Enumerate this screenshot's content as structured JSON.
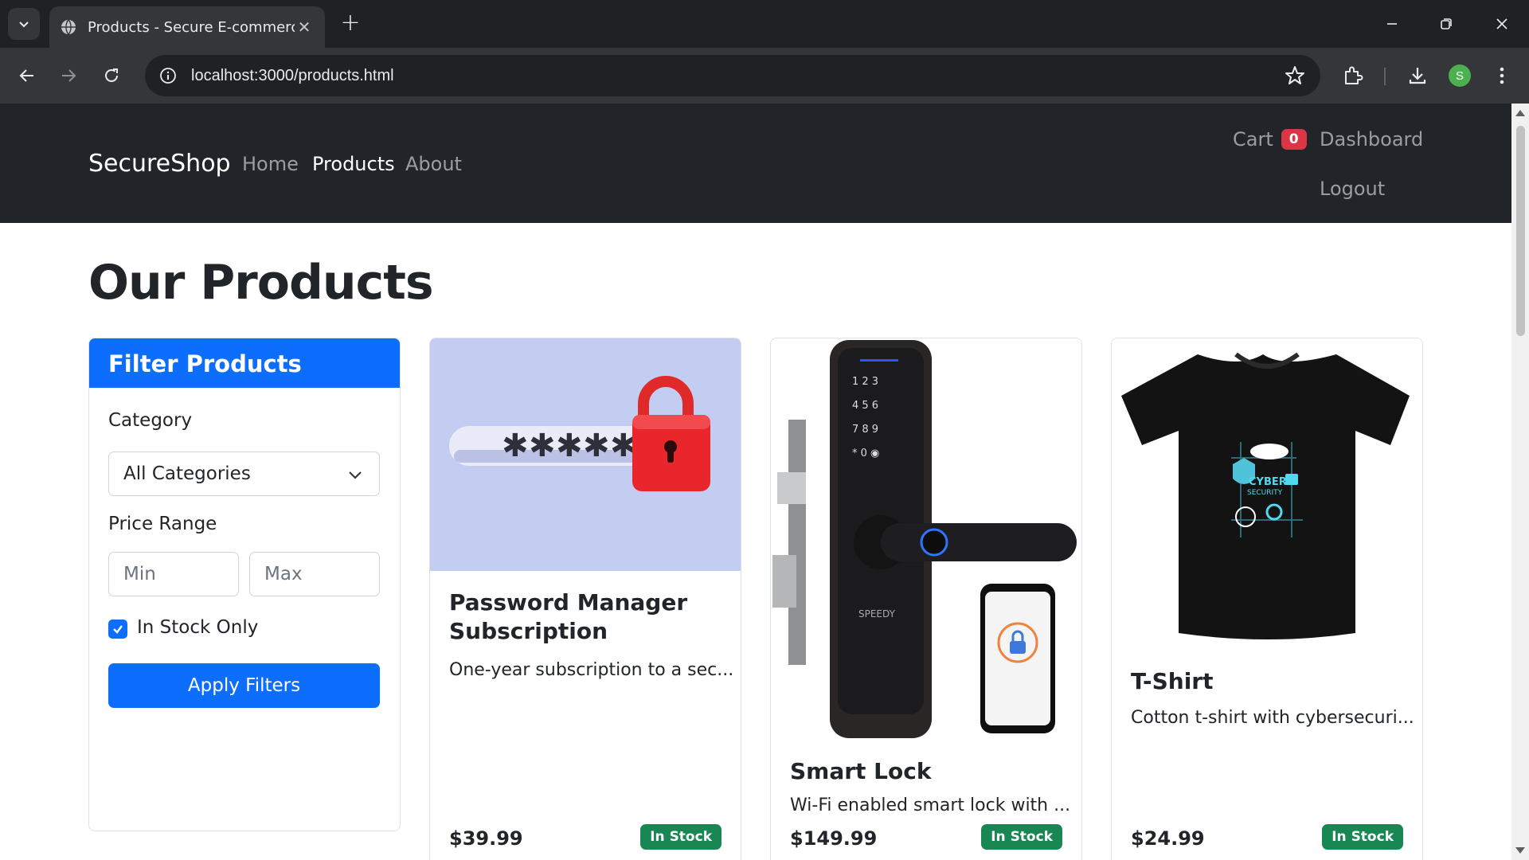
{
  "browser": {
    "tab_title": "Products - Secure E-commerce",
    "url": "localhost:3000/products.html",
    "profile_initial": "S"
  },
  "nav": {
    "brand": "SecureShop",
    "links": [
      "Home",
      "Products",
      "About"
    ],
    "active": "Products",
    "cart_label": "Cart",
    "cart_count": "0",
    "dashboard": "Dashboard",
    "logout": "Logout"
  },
  "page": {
    "title": "Our Products"
  },
  "filter": {
    "header": "Filter Products",
    "category_label": "Category",
    "category_value": "All Categories",
    "price_label": "Price Range",
    "min_placeholder": "Min",
    "max_placeholder": "Max",
    "in_stock_label": "In Stock Only",
    "in_stock_checked": true,
    "apply_label": "Apply Filters"
  },
  "products": [
    {
      "name": "Password Manager Subscription",
      "description": "One-year subscription to a sec...",
      "price": "$39.99",
      "stock": "In Stock"
    },
    {
      "name": "Smart Lock",
      "description": "Wi-Fi enabled smart lock with ...",
      "price": "$149.99",
      "stock": "In Stock"
    },
    {
      "name": "T-Shirt",
      "description": "Cotton t-shirt with cybersecuri...",
      "price": "$24.99",
      "stock": "In Stock"
    }
  ],
  "colors": {
    "primary": "#0d6efd",
    "navbar": "#212529",
    "badge_danger": "#dc3545",
    "badge_success": "#198754"
  },
  "icons": [
    "tab-list-icon",
    "globe-icon",
    "close-icon",
    "plus-icon",
    "minimize-icon",
    "restore-icon",
    "back-icon",
    "forward-icon",
    "reload-icon",
    "site-info-icon",
    "star-icon",
    "extensions-icon",
    "download-icon",
    "more-icon",
    "chevron-down-icon",
    "check-icon"
  ]
}
